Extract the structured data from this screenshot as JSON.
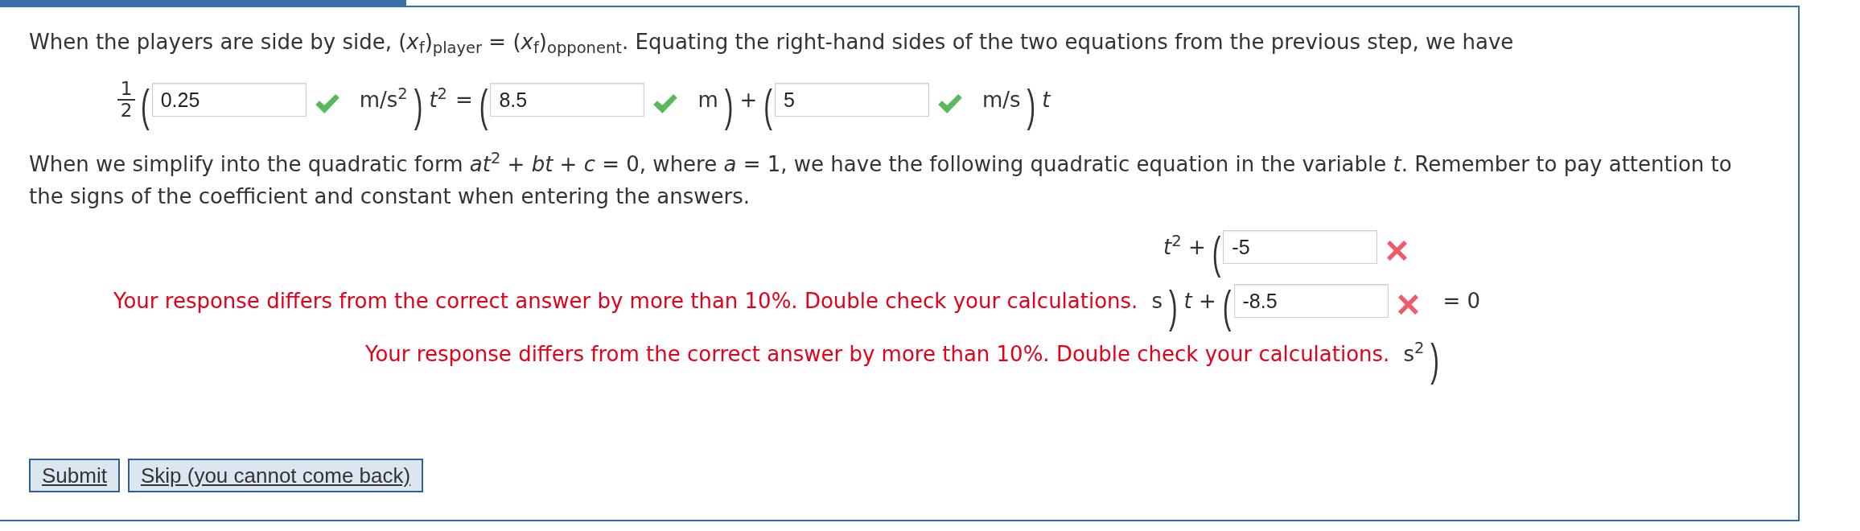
{
  "intro": "When the players are side by side, (*x*$_{f}$)$_{player}$ = (*x*$_{f}$)$_{opponent}$. Equating the right-hand sides of the two equations from the previous step, we have",
  "equation": {
    "items": [
      {
        "kind": "fraction",
        "numerator": "1",
        "denominator": "2"
      },
      {
        "kind": "bracket",
        "text": "("
      },
      {
        "kind": "answer",
        "value": "0.25",
        "correct": true
      },
      {
        "kind": "math",
        "text": "m/s$^{2}$"
      },
      {
        "kind": "bracket",
        "text": ")"
      },
      {
        "kind": "math",
        "text": "*t*$^{2}$"
      },
      {
        "kind": "math",
        "text": "="
      },
      {
        "kind": "bracket",
        "text": "("
      },
      {
        "kind": "answer",
        "value": "8.5",
        "correct": true
      },
      {
        "kind": "math",
        "text": "m"
      },
      {
        "kind": "bracket",
        "text": ")"
      },
      {
        "kind": "math",
        "text": "+"
      },
      {
        "kind": "bracket",
        "text": "("
      },
      {
        "kind": "answer",
        "value": "5",
        "correct": true
      },
      {
        "kind": "math",
        "text": "m/s"
      },
      {
        "kind": "bracket",
        "text": ")"
      },
      {
        "kind": "math",
        "text": "*t*"
      }
    ]
  },
  "instructions": "When we simplify into the quadratic form *at*$^{2}$ + *bt* + *c* = 0, where *a* = 1, we have the following quadratic equation in the variable *t*. Remember to pay attention to the signs of the coefficient and constant when entering the answers.",
  "quadratic": {
    "lines": [
      {
        "items": [
          {
            "kind": "math",
            "text": "*t*$^{2}$ +"
          },
          {
            "kind": "bracket",
            "text": "("
          },
          {
            "kind": "answer",
            "value": "-5",
            "correct": false
          }
        ]
      },
      {
        "items": [
          {
            "kind": "feedback",
            "text": "Your response differs from the correct answer by more than 10%. Double check your calculations."
          },
          {
            "kind": "math",
            "text": "s"
          },
          {
            "kind": "bracket",
            "text": ")"
          },
          {
            "kind": "math",
            "text": "*t* +"
          },
          {
            "kind": "bracket",
            "text": "("
          },
          {
            "kind": "answer",
            "value": "-8.5",
            "correct": false
          },
          {
            "kind": "math",
            "text": "= 0"
          }
        ]
      },
      {
        "items": [
          {
            "kind": "feedback",
            "text": "Your response differs from the correct answer by more than 10%. Double check your calculations."
          },
          {
            "kind": "math",
            "text": "s$^{2}$"
          },
          {
            "kind": "bracket",
            "text": ")"
          }
        ]
      }
    ]
  },
  "buttons": [
    {
      "label": "Submit"
    },
    {
      "label": "Skip (you cannot come back)"
    }
  ]
}
